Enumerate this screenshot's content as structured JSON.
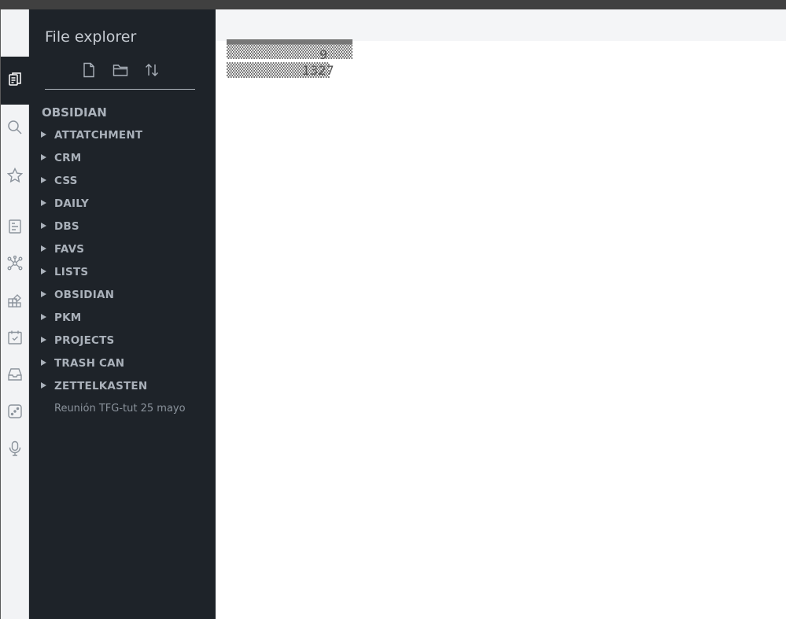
{
  "sidebar": {
    "title": "File explorer",
    "vault_name": "OBSIDIAN",
    "folders": [
      {
        "label": "ATTATCHMENT"
      },
      {
        "label": "CRM"
      },
      {
        "label": "CSS"
      },
      {
        "label": "DAILY"
      },
      {
        "label": "DBS"
      },
      {
        "label": "FAVS"
      },
      {
        "label": "LISTS"
      },
      {
        "label": "OBSIDIAN"
      },
      {
        "label": "PKM"
      },
      {
        "label": "PROJECTS"
      },
      {
        "label": "TRASH CAN"
      },
      {
        "label": "ZETTELKASTEN"
      }
    ],
    "files": [
      {
        "label": "Reunión TFG-tut 25 mayo"
      }
    ]
  },
  "ribbon": {
    "icons": [
      "file-explorer-icon",
      "search-icon",
      "star-icon",
      "outline-icon",
      "graph-icon",
      "plugins-icon",
      "calendar-icon",
      "inbox-icon",
      "dice-icon",
      "microphone-icon"
    ]
  },
  "main": {
    "overlapping_text": [
      "9",
      "1327"
    ]
  },
  "colors": {
    "sidebar_bg": "#1e2329",
    "ribbon_bg": "#f2f3f5",
    "topbar": "#404040",
    "text_muted": "#aab1ba"
  }
}
